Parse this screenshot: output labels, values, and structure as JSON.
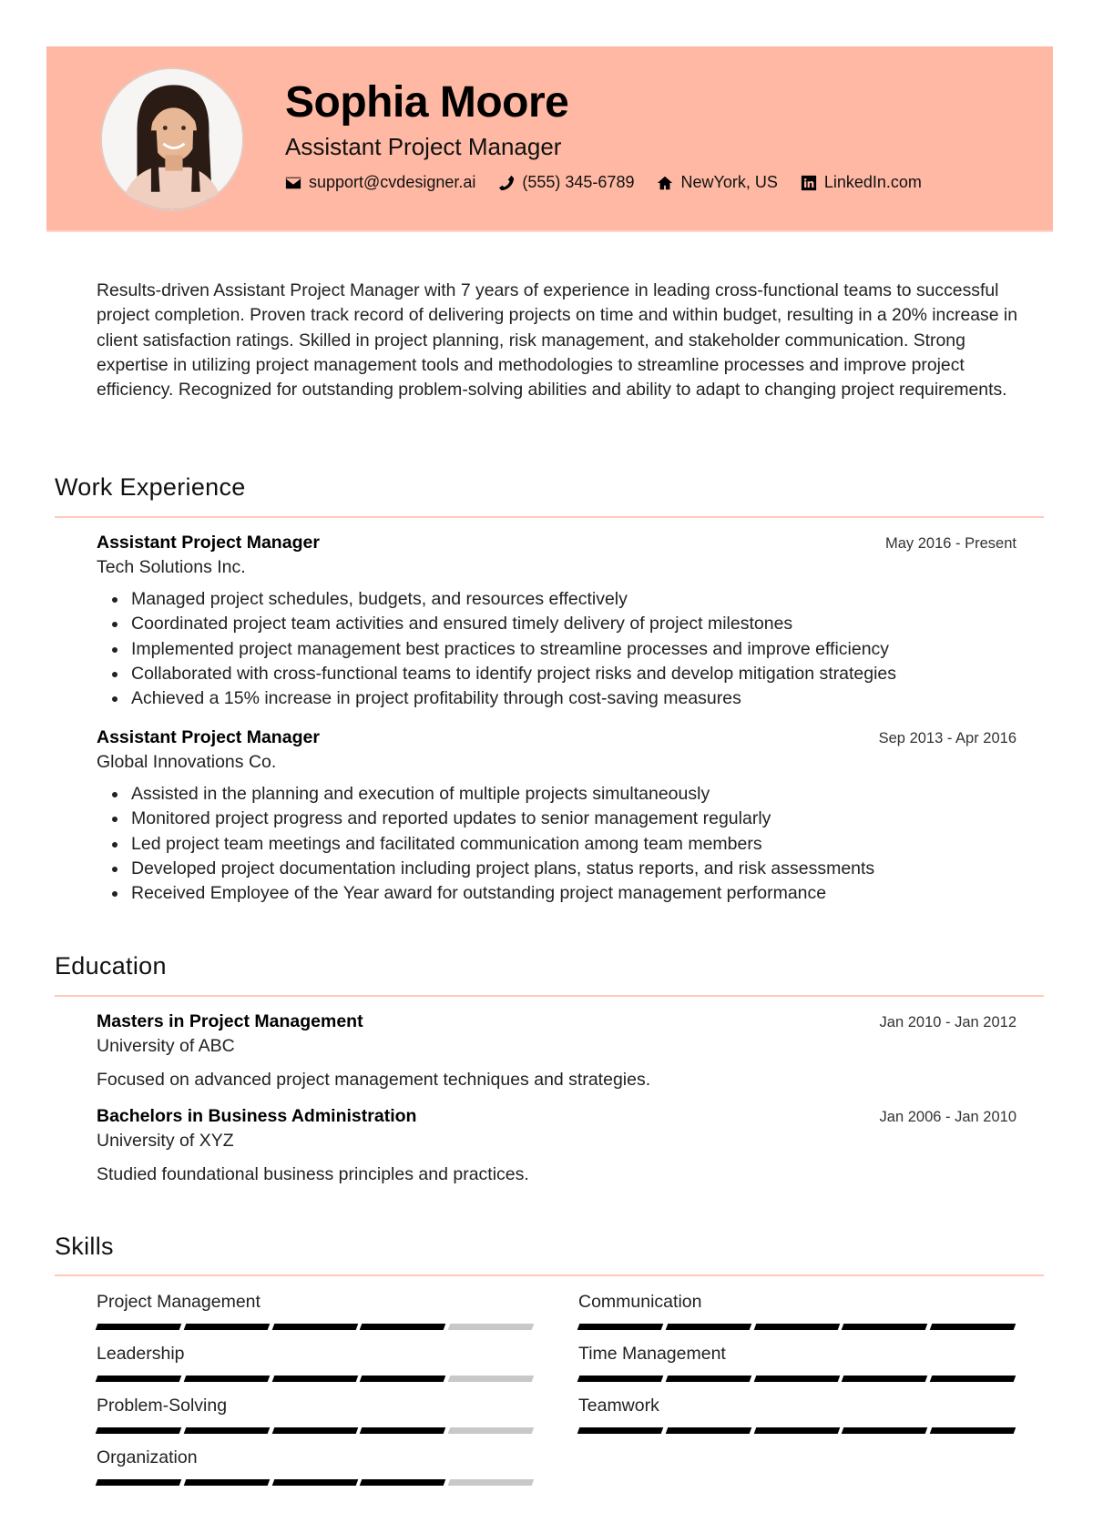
{
  "header": {
    "name": "Sophia Moore",
    "title": "Assistant Project Manager",
    "accent_color": "#ffb8a3",
    "contacts": [
      {
        "icon": "envelope-icon",
        "text": "support@cvdesigner.ai"
      },
      {
        "icon": "phone-icon",
        "text": "(555) 345-6789"
      },
      {
        "icon": "home-icon",
        "text": "NewYork, US"
      },
      {
        "icon": "linkedin-icon",
        "text": "LinkedIn.com"
      }
    ]
  },
  "summary": "Results-driven Assistant Project Manager with 7 years of experience in leading cross-functional teams to successful project completion. Proven track record of delivering projects on time and within budget, resulting in a 20% increase in client satisfaction ratings. Skilled in project planning, risk management, and stakeholder communication. Strong expertise in utilizing project management tools and methodologies to streamline processes and improve project efficiency. Recognized for outstanding problem-solving abilities and ability to adapt to changing project requirements.",
  "work": {
    "heading": "Work Experience",
    "jobs": [
      {
        "role": "Assistant Project Manager",
        "company": "Tech Solutions Inc.",
        "dates": "May 2016 - Present",
        "bullets": [
          "Managed project schedules, budgets, and resources effectively",
          "Coordinated project team activities and ensured timely delivery of project milestones",
          "Implemented project management best practices to streamline processes and improve efficiency",
          "Collaborated with cross-functional teams to identify project risks and develop mitigation strategies",
          "Achieved a 15% increase in project profitability through cost-saving measures"
        ]
      },
      {
        "role": "Assistant Project Manager",
        "company": "Global Innovations Co.",
        "dates": "Sep 2013 - Apr 2016",
        "bullets": [
          "Assisted in the planning and execution of multiple projects simultaneously",
          "Monitored project progress and reported updates to senior management regularly",
          "Led project team meetings and facilitated communication among team members",
          "Developed project documentation including project plans, status reports, and risk assessments",
          "Received Employee of the Year award for outstanding project management performance"
        ]
      }
    ]
  },
  "education": {
    "heading": "Education",
    "items": [
      {
        "degree": "Masters in Project Management",
        "school": "University of ABC",
        "dates": "Jan 2010 - Jan 2012",
        "description": "Focused on advanced project management techniques and strategies."
      },
      {
        "degree": "Bachelors in Business Administration",
        "school": "University of XYZ",
        "dates": "Jan 2006 - Jan 2010",
        "description": "Studied foundational business principles and practices."
      }
    ]
  },
  "skills": {
    "heading": "Skills",
    "max_level": 5,
    "items": [
      {
        "name": "Project Management",
        "level": 4
      },
      {
        "name": "Communication",
        "level": 5
      },
      {
        "name": "Leadership",
        "level": 4
      },
      {
        "name": "Time Management",
        "level": 5
      },
      {
        "name": "Problem-Solving",
        "level": 4
      },
      {
        "name": "Teamwork",
        "level": 5
      },
      {
        "name": "Organization",
        "level": 4
      }
    ]
  }
}
